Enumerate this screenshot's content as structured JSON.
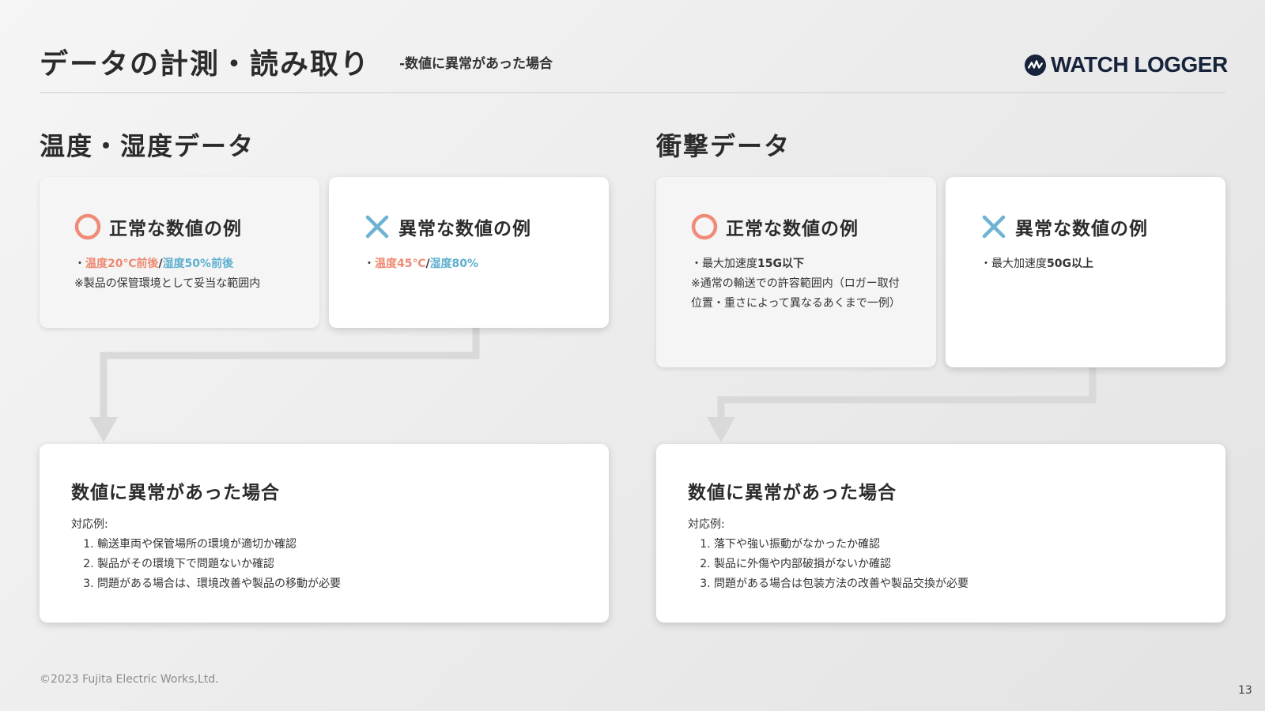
{
  "header": {
    "title": "データの計測・読み取り",
    "subtitle": "-数値に異常があった場合",
    "logo_text": "WATCH LOGGER"
  },
  "sections": {
    "temp": {
      "title": "温度・湿度データ",
      "normal": {
        "heading": "正常な数値の例",
        "bullet": "・",
        "v1": "温度20℃前後",
        "sep": "/",
        "v2": "湿度50%前後",
        "note": "※製品の保管環境として妥当な範囲内"
      },
      "abnormal": {
        "heading": "異常な数値の例",
        "bullet": "・",
        "v1": "温度45℃",
        "sep": "/",
        "v2": "湿度80%"
      },
      "result": {
        "title": "数値に異常があった場合",
        "intro": "対応例:",
        "items": [
          "輸送車両や保管場所の環境が適切か確認",
          "製品がその環境下で問題ないか確認",
          "問題がある場合は、環境改善や製品の移動が必要"
        ]
      }
    },
    "shock": {
      "title": "衝撃データ",
      "normal": {
        "heading": "正常な数値の例",
        "prefix": "・最大加速度",
        "value": "15G以下",
        "note": "※通常の輸送での許容範囲内（ロガー取付位置・重さによって異なるあくまで一例）"
      },
      "abnormal": {
        "heading": "異常な数値の例",
        "prefix": "・最大加速度",
        "value": "50G以上"
      },
      "result": {
        "title": "数値に異常があった場合",
        "intro": "対応例:",
        "items": [
          "落下や強い振動がなかったか確認",
          "製品に外傷や内部破損がないか確認",
          "問題がある場合は包装方法の改善や製品交換が必要"
        ]
      }
    }
  },
  "footer": {
    "copyright": "©2023 Fujita Electric Works,Ltd.",
    "page_number": "13"
  },
  "colors": {
    "normal_icon": "#ef8b77",
    "abnormal_icon": "#6fb3d3",
    "temperature": "#ee8a72",
    "humidity": "#5fb0cf",
    "logo": "#16233b",
    "arrow": "#d9d9d9"
  }
}
